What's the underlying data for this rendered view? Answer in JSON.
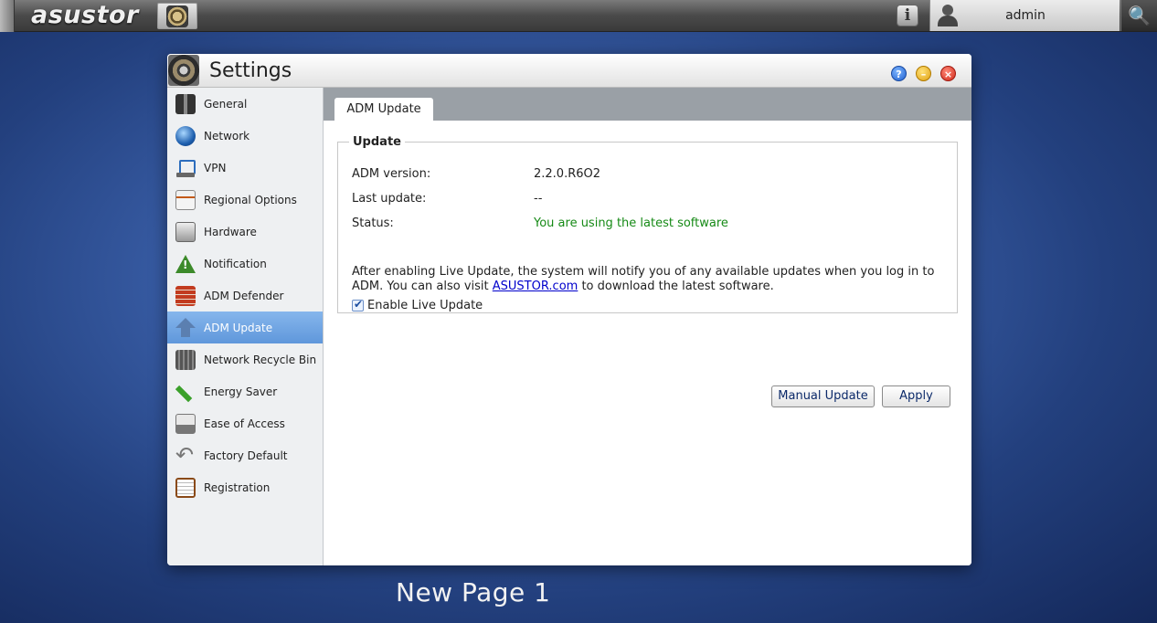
{
  "topbar": {
    "logo_text": "asustor",
    "user_name": "admin",
    "search_glyph": "🔍",
    "info_glyph": "i"
  },
  "window": {
    "title": "Settings"
  },
  "sidebar": {
    "items": [
      {
        "label": "General",
        "icon": "server-icon"
      },
      {
        "label": "Network",
        "icon": "globe-icon"
      },
      {
        "label": "VPN",
        "icon": "vpn-icon"
      },
      {
        "label": "Regional Options",
        "icon": "calendar-clock-icon"
      },
      {
        "label": "Hardware",
        "icon": "hardware-icon"
      },
      {
        "label": "Notification",
        "icon": "warning-icon"
      },
      {
        "label": "ADM Defender",
        "icon": "firewall-icon"
      },
      {
        "label": "ADM Update",
        "icon": "upload-arrow-icon",
        "active": true
      },
      {
        "label": "Network Recycle Bin",
        "icon": "trash-icon"
      },
      {
        "label": "Energy Saver",
        "icon": "energy-icon"
      },
      {
        "label": "Ease of Access",
        "icon": "printer-icon"
      },
      {
        "label": "Factory Default",
        "icon": "undo-icon"
      },
      {
        "label": "Registration",
        "icon": "clipboard-icon"
      }
    ]
  },
  "content": {
    "tab_label": "ADM Update",
    "group_title": "Update",
    "adm_version_label": "ADM version:",
    "adm_version_value": "2.2.0.R6O2",
    "last_update_label": "Last update:",
    "last_update_value": "--",
    "status_label": "Status:",
    "status_value": "You are using the latest software",
    "desc_part1": "After enabling Live Update, the system will notify you of any available updates when you log in to ADM. You can also visit ",
    "desc_link": "ASUSTOR.com",
    "desc_part2": " to download the latest software.",
    "enable_live_update_label": "Enable Live Update",
    "enable_live_update_checked": true,
    "manual_update_label": "Manual Update",
    "apply_label": "Apply"
  },
  "caption": "New Page 1",
  "colors": {
    "status_ok": "#168a16",
    "sidebar_active": "#6fa5e3",
    "link": "#0000cc"
  }
}
